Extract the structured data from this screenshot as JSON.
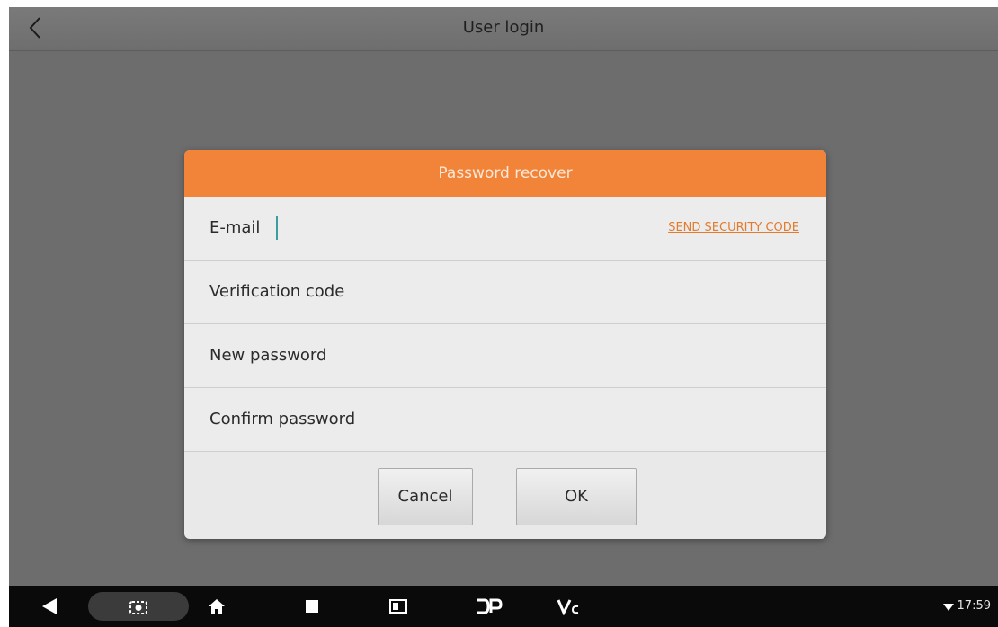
{
  "header": {
    "title": "User login"
  },
  "dialog": {
    "title": "Password recover",
    "fields": [
      {
        "label": "E-mail"
      },
      {
        "label": "Verification code"
      },
      {
        "label": "New password"
      },
      {
        "label": "Confirm password"
      }
    ],
    "send_code_label": "SEND SECURITY CODE",
    "cancel_label": "Cancel",
    "ok_label": "OK"
  },
  "status_bar": {
    "time": "17:59"
  },
  "icons": {
    "back": "chevron-left-icon",
    "nav_back": "triangle-back-icon",
    "screenshot": "camera-icon",
    "home": "home-icon",
    "recents": "square-icon",
    "window": "window-icon",
    "dp": "dp-logo",
    "vci": "vci-logo",
    "wifi": "wifi-icon"
  },
  "colors": {
    "accent": "#f2843a",
    "link": "#e27b2d"
  }
}
